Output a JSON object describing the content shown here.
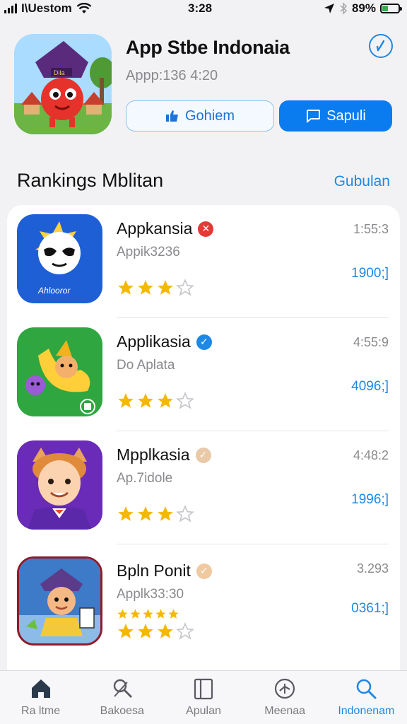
{
  "status": {
    "carrier": "I\\Uestom",
    "time": "3:28",
    "battery": "89%"
  },
  "header": {
    "title": "App Stbe Indonaia",
    "subtitle": "Appp:136 4:20",
    "outline_button": "Gohiem",
    "solid_button": "Sapuli"
  },
  "section": {
    "title": "Rankings Mblitan",
    "link": "Gubulan"
  },
  "apps": [
    {
      "name": "Appkansia",
      "badge_color": "#e53935",
      "sub": "Appik3236",
      "meta": "1:55:3",
      "count": "1900;]",
      "rating": 3
    },
    {
      "name": "Applikasia",
      "badge_color": "#1e88e5",
      "sub": "Do Aplata",
      "meta": "4:55:9",
      "count": "4096;]",
      "rating": 3
    },
    {
      "name": "Mpplkasia",
      "badge_color": "#e8c9a8",
      "sub": "Ap.7idole",
      "meta": "4:48:2",
      "count": "1996;]",
      "rating": 3
    },
    {
      "name": "Bpln Ponit",
      "badge_color": "#f0c9a0",
      "sub": "Applk33:30",
      "meta": "3.293",
      "count": "0361;]",
      "rating": 3
    }
  ],
  "tabs": [
    {
      "label": "Ra ltme",
      "icon": "home-icon"
    },
    {
      "label": "Bakoesa",
      "icon": "magnifier-tools-icon"
    },
    {
      "label": "Apulan",
      "icon": "book-icon"
    },
    {
      "label": "Meenaa",
      "icon": "compass-icon"
    },
    {
      "label": "Indonenam",
      "icon": "search-icon"
    }
  ],
  "colors": {
    "accent": "#1e88e5",
    "primary_button": "#0a7cf0",
    "star": "#f5b800"
  }
}
